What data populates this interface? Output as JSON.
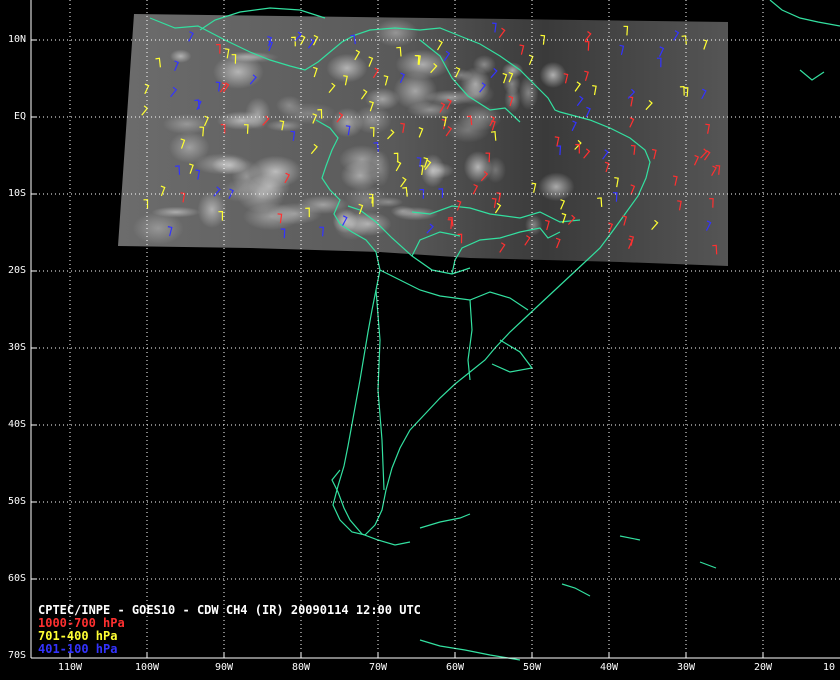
{
  "title": "CPTEC/INPE - GOES10 - CDW CH4 (IR) 20090114 12:00 UTC",
  "legend": {
    "low": {
      "label": "1000-700 hPa",
      "color": "#ff3030"
    },
    "mid": {
      "label": "701-400 hPa",
      "color": "#ffff33"
    },
    "high": {
      "label": "401-100 hPa",
      "color": "#3333ff"
    }
  },
  "axes": {
    "lat_labels": [
      "10N",
      "EQ",
      "10S",
      "20S",
      "30S",
      "40S",
      "50S",
      "60S",
      "70S"
    ],
    "lon_labels": [
      "110W",
      "100W",
      "90W",
      "80W",
      "70W",
      "60W",
      "50W",
      "40W",
      "30W",
      "20W",
      "10"
    ]
  },
  "colors": {
    "coastline": "#33e0a0",
    "grid": "#ffffff",
    "background": "#000000"
  }
}
